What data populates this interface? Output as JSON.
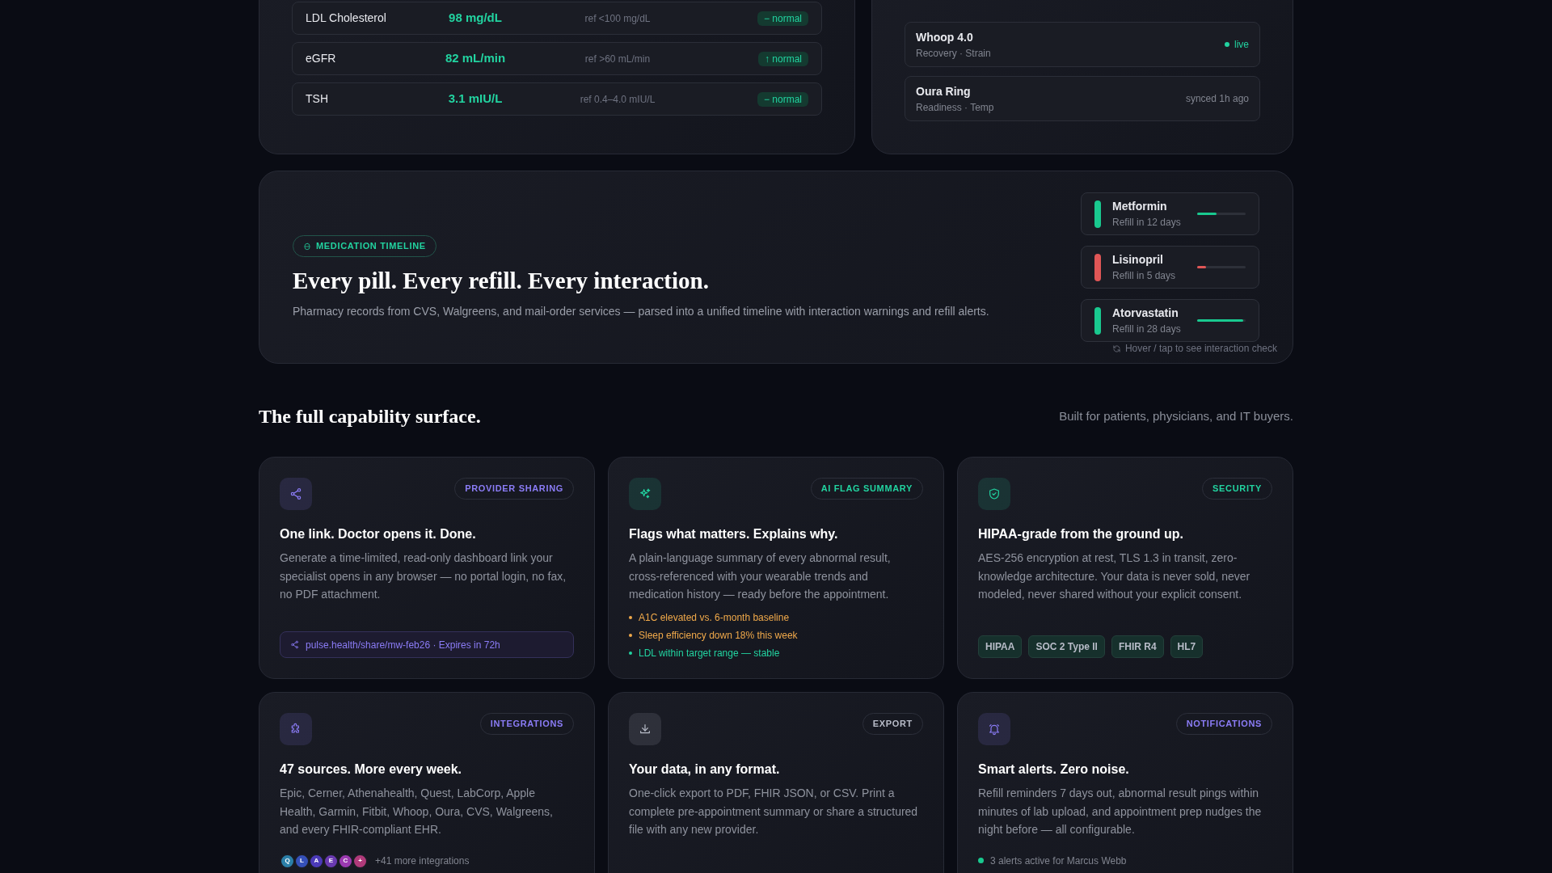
{
  "labs": [
    {
      "name": "LDL Cholesterol",
      "value": "98 mg/dL",
      "ref": "ref <100 mg/dL",
      "status": "− normal"
    },
    {
      "name": "eGFR",
      "value": "82 mL/min",
      "ref": "ref >60 mL/min",
      "status": "↑ normal"
    },
    {
      "name": "TSH",
      "value": "3.1 mIU/L",
      "ref": "ref 0.4–4.0 mIU/L",
      "status": "− normal"
    }
  ],
  "devices": [
    {
      "name": "Whoop 4.0",
      "metrics": "Recovery · Strain",
      "status": "live",
      "live": true
    },
    {
      "name": "Oura Ring",
      "metrics": "Readiness · Temp",
      "status": "synced 1h ago",
      "live": false
    }
  ],
  "medication": {
    "badge": "MEDICATION TIMELINE",
    "heading": "Every pill. Every refill. Every interaction.",
    "description": "Pharmacy records from CVS, Walgreens, and mail-order services — parsed into a unified timeline with interaction warnings and refill alerts.",
    "meds": [
      {
        "name": "Metformin",
        "refill": "Refill in 12 days",
        "level": 0.4,
        "color": "#19c98f"
      },
      {
        "name": "Lisinopril",
        "refill": "Refill in 5 days",
        "level": 0.18,
        "color": "#e05656"
      },
      {
        "name": "Atorvastatin",
        "refill": "Refill in 28 days",
        "level": 0.95,
        "color": "#19c98f"
      }
    ],
    "hint": "Hover / tap to see interaction check"
  },
  "capabilities": {
    "title": "The full capability surface.",
    "subtitle": "Built for patients, physicians, and IT buyers.",
    "cards": [
      {
        "badge": "PROVIDER SHARING",
        "color": "#8b7cf6",
        "title": "One link. Doctor opens it. Done.",
        "description": "Generate a time-limited, read-only dashboard link your specialist opens in any browser — no portal login, no fax, no PDF attachment.",
        "footer": {
          "kind": "link",
          "text": "pulse.health/share/mw-feb26 · Expires in 72h"
        }
      },
      {
        "badge": "AI FLAG SUMMARY",
        "color": "#22d3a0",
        "title": "Flags what matters. Explains why.",
        "description": "A plain-language summary of every abnormal result, cross-referenced with your wearable trends and medication history — ready before the appointment.",
        "footer": {
          "kind": "bullets",
          "items": [
            {
              "text": "A1C elevated vs. 6-month baseline",
              "color": "#f0a94a"
            },
            {
              "text": "Sleep efficiency down 18% this week",
              "color": "#f0a94a"
            },
            {
              "text": "LDL within target range — stable",
              "color": "#22d3a0"
            }
          ]
        }
      },
      {
        "badge": "SECURITY",
        "color": "#22d3a0",
        "title": "HIPAA-grade from the ground up.",
        "description": "AES-256 encryption at rest, TLS 1.3 in transit, zero-knowledge architecture. Your data is never sold, never modeled, never shared without your explicit consent.",
        "footer": {
          "kind": "tags",
          "items": [
            "HIPAA",
            "SOC 2 Type II",
            "FHIR R4",
            "HL7"
          ]
        }
      },
      {
        "badge": "INTEGRATIONS",
        "color": "#8b7cf6",
        "title": "47 sources. More every week.",
        "description": "Epic, Cerner, Athenahealth, Quest, LabCorp, Apple Health, Garmin, Fitbit, Whoop, Oura, CVS, Walgreens, and every FHIR-compliant EHR.",
        "footer": {
          "kind": "avatars",
          "items": [
            {
              "text": "Q",
              "color": "#2b7fa8"
            },
            {
              "text": "L",
              "color": "#3550b8"
            },
            {
              "text": "A",
              "color": "#4b3ab8"
            },
            {
              "text": "E",
              "color": "#6a3ab0"
            },
            {
              "text": "C",
              "color": "#9b3ab0"
            },
            {
              "text": "+",
              "color": "#b03a7a"
            }
          ],
          "text": "+41 more integrations"
        }
      },
      {
        "badge": "EXPORT",
        "color": "#b8bcc8",
        "title": "Your data, in any format.",
        "description": "One-click export to PDF, FHIR JSON, or CSV. Print a complete pre-appointment summary or share a structured file with any new provider."
      },
      {
        "badge": "NOTIFICATIONS",
        "color": "#8b7cf6",
        "title": "Smart alerts. Zero noise.",
        "description": "Refill reminders 7 days out, abnormal result pings within minutes of lab upload, and appointment prep nudges the night before — all configurable.",
        "footer": {
          "kind": "status",
          "text": "3 alerts active for Marcus Webb",
          "color": "#19c98f"
        }
      }
    ]
  }
}
